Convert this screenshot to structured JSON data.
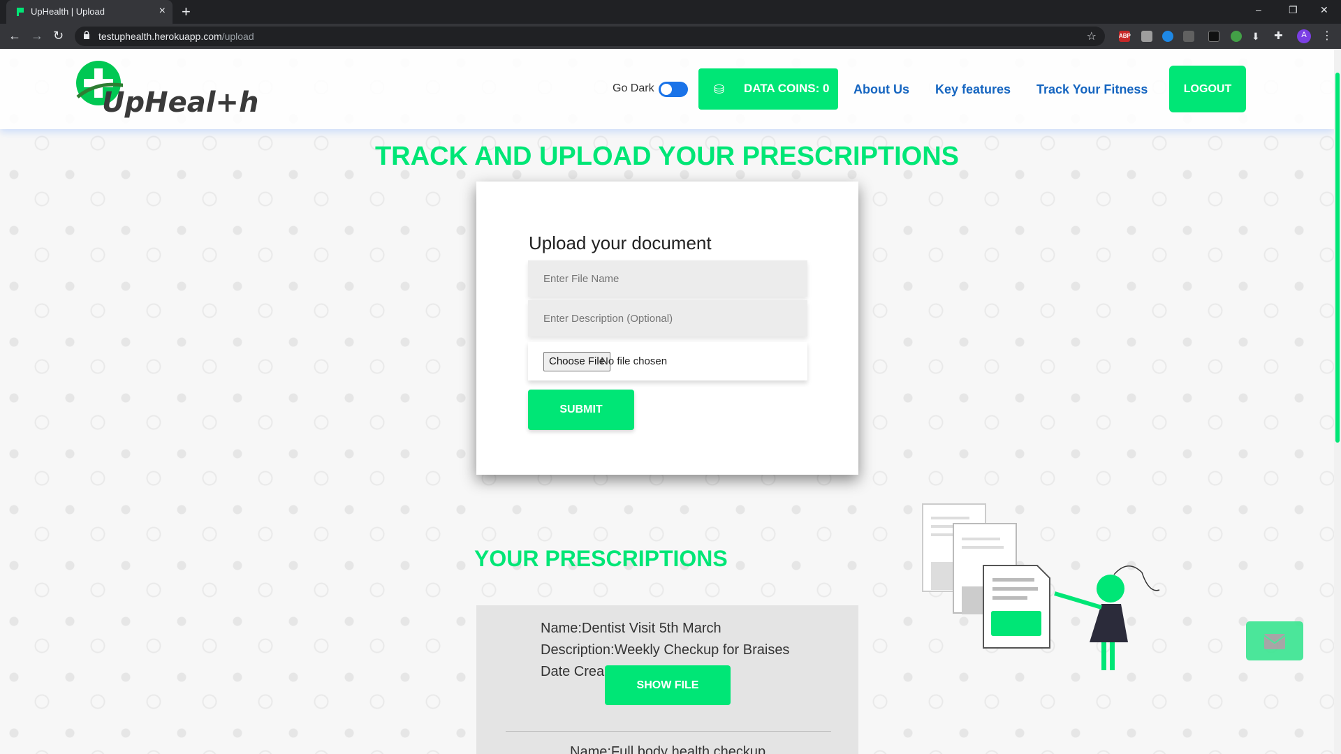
{
  "browser": {
    "tab_title": "UpHealth | Upload",
    "url_host": "testuphealth.herokuapp.com",
    "url_path": "/upload",
    "profile_initial": "A",
    "ext_badge": "ABP"
  },
  "header": {
    "logo_text": "UpHeal+h",
    "go_dark_label": "Go Dark",
    "coins_label": "DATA COINS: 0",
    "nav": [
      "About Us",
      "Key features",
      "Track Your Fitness"
    ],
    "logout_label": "LOGOUT"
  },
  "upload": {
    "heading": "TRACK AND UPLOAD YOUR PRESCRIPTIONS",
    "card_title": "Upload your document",
    "file_name_placeholder": "Enter File Name",
    "description_placeholder": "Enter Description (Optional)",
    "choose_file_label": "Choose File",
    "no_file_text": "No file chosen",
    "submit_label": "SUBMIT"
  },
  "prescriptions": {
    "heading": "YOUR PRESCRIPTIONS",
    "items": [
      {
        "name": "Name:Dentist Visit 5th March",
        "description": "Description:Weekly Checkup for Braises",
        "date": "Date Crea",
        "button": "SHOW FILE"
      },
      {
        "name": "Name:Full body health checkup"
      }
    ]
  },
  "colors": {
    "accent": "#00e676",
    "link": "#1565c0"
  }
}
